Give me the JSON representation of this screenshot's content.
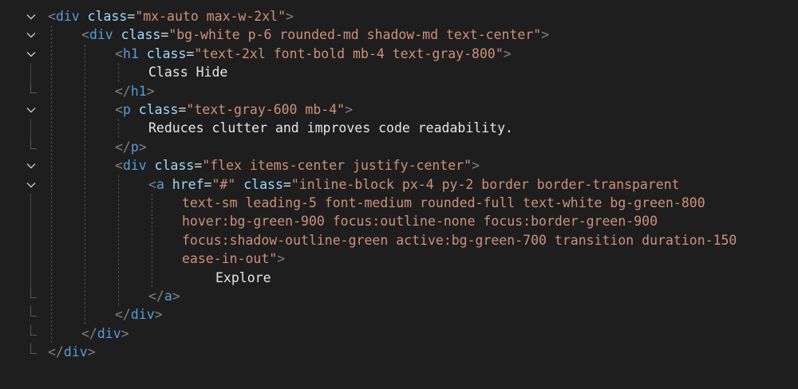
{
  "editor": {
    "lines": [
      {
        "parts": [
          [
            "punct",
            "<"
          ],
          [
            "tag",
            "div"
          ],
          [
            "attr",
            " class"
          ],
          [
            "eq",
            "="
          ],
          [
            "str",
            "\"mx-auto max-w-2xl\""
          ],
          [
            "punct",
            ">"
          ]
        ]
      },
      {
        "parts": [
          [
            "punct",
            "<"
          ],
          [
            "tag",
            "div"
          ],
          [
            "attr",
            " class"
          ],
          [
            "eq",
            "="
          ],
          [
            "str",
            "\"bg-white p-6 rounded-md shadow-md text-center\""
          ],
          [
            "punct",
            ">"
          ]
        ]
      },
      {
        "parts": [
          [
            "punct",
            "<"
          ],
          [
            "tag",
            "h1"
          ],
          [
            "attr",
            " class"
          ],
          [
            "eq",
            "="
          ],
          [
            "str",
            "\"text-2xl font-bold mb-4 text-gray-800\""
          ],
          [
            "punct",
            ">"
          ]
        ]
      },
      {
        "parts": [
          [
            "txt",
            "Class Hide"
          ]
        ]
      },
      {
        "parts": [
          [
            "punct",
            "</"
          ],
          [
            "tag",
            "h1"
          ],
          [
            "punct",
            ">"
          ]
        ]
      },
      {
        "parts": [
          [
            "punct",
            "<"
          ],
          [
            "tag",
            "p"
          ],
          [
            "attr",
            " class"
          ],
          [
            "eq",
            "="
          ],
          [
            "str",
            "\"text-gray-600 mb-4\""
          ],
          [
            "punct",
            ">"
          ]
        ]
      },
      {
        "parts": [
          [
            "txt",
            "Reduces clutter and improves code readability."
          ]
        ]
      },
      {
        "parts": [
          [
            "punct",
            "</"
          ],
          [
            "tag",
            "p"
          ],
          [
            "punct",
            ">"
          ]
        ]
      },
      {
        "parts": [
          [
            "punct",
            "<"
          ],
          [
            "tag",
            "div"
          ],
          [
            "attr",
            " class"
          ],
          [
            "eq",
            "="
          ],
          [
            "str",
            "\"flex items-center justify-center\""
          ],
          [
            "punct",
            ">"
          ]
        ]
      },
      {
        "parts": [
          [
            "punct",
            "<"
          ],
          [
            "tag",
            "a"
          ],
          [
            "attr",
            " href"
          ],
          [
            "eq",
            "="
          ],
          [
            "str",
            "\"#\""
          ],
          [
            "attr",
            " class"
          ],
          [
            "eq",
            "="
          ],
          [
            "str",
            "\"inline-block px-4 py-2 border border-transparent"
          ]
        ]
      },
      {
        "parts": [
          [
            "str",
            "text-sm leading-5 font-medium rounded-full text-white bg-green-800"
          ]
        ]
      },
      {
        "parts": [
          [
            "str",
            "hover:bg-green-900 focus:outline-none focus:border-green-900"
          ]
        ]
      },
      {
        "parts": [
          [
            "str",
            "focus:shadow-outline-green active:bg-green-700 transition duration-150"
          ]
        ]
      },
      {
        "parts": [
          [
            "str",
            "ease-in-out\""
          ],
          [
            "punct",
            ">"
          ]
        ]
      },
      {
        "parts": [
          [
            "txt",
            "Explore"
          ]
        ]
      },
      {
        "parts": [
          [
            "punct",
            "</"
          ],
          [
            "tag",
            "a"
          ],
          [
            "punct",
            ">"
          ]
        ]
      },
      {
        "parts": [
          [
            "punct",
            "</"
          ],
          [
            "tag",
            "div"
          ],
          [
            "punct",
            ">"
          ]
        ]
      },
      {
        "parts": [
          [
            "punct",
            "</"
          ],
          [
            "tag",
            "div"
          ],
          [
            "punct",
            ">"
          ]
        ]
      },
      {
        "parts": [
          [
            "punct",
            "</"
          ],
          [
            "tag",
            "div"
          ],
          [
            "punct",
            ">"
          ]
        ]
      }
    ],
    "icons": {
      "fold_open": "chevron-down-icon"
    },
    "colors": {
      "background": "#1e1e1e",
      "tag": "#569cd6",
      "attribute": "#9cdcfe",
      "string": "#ce9178",
      "punctuation": "#808080",
      "text": "#e6e6e6"
    }
  }
}
